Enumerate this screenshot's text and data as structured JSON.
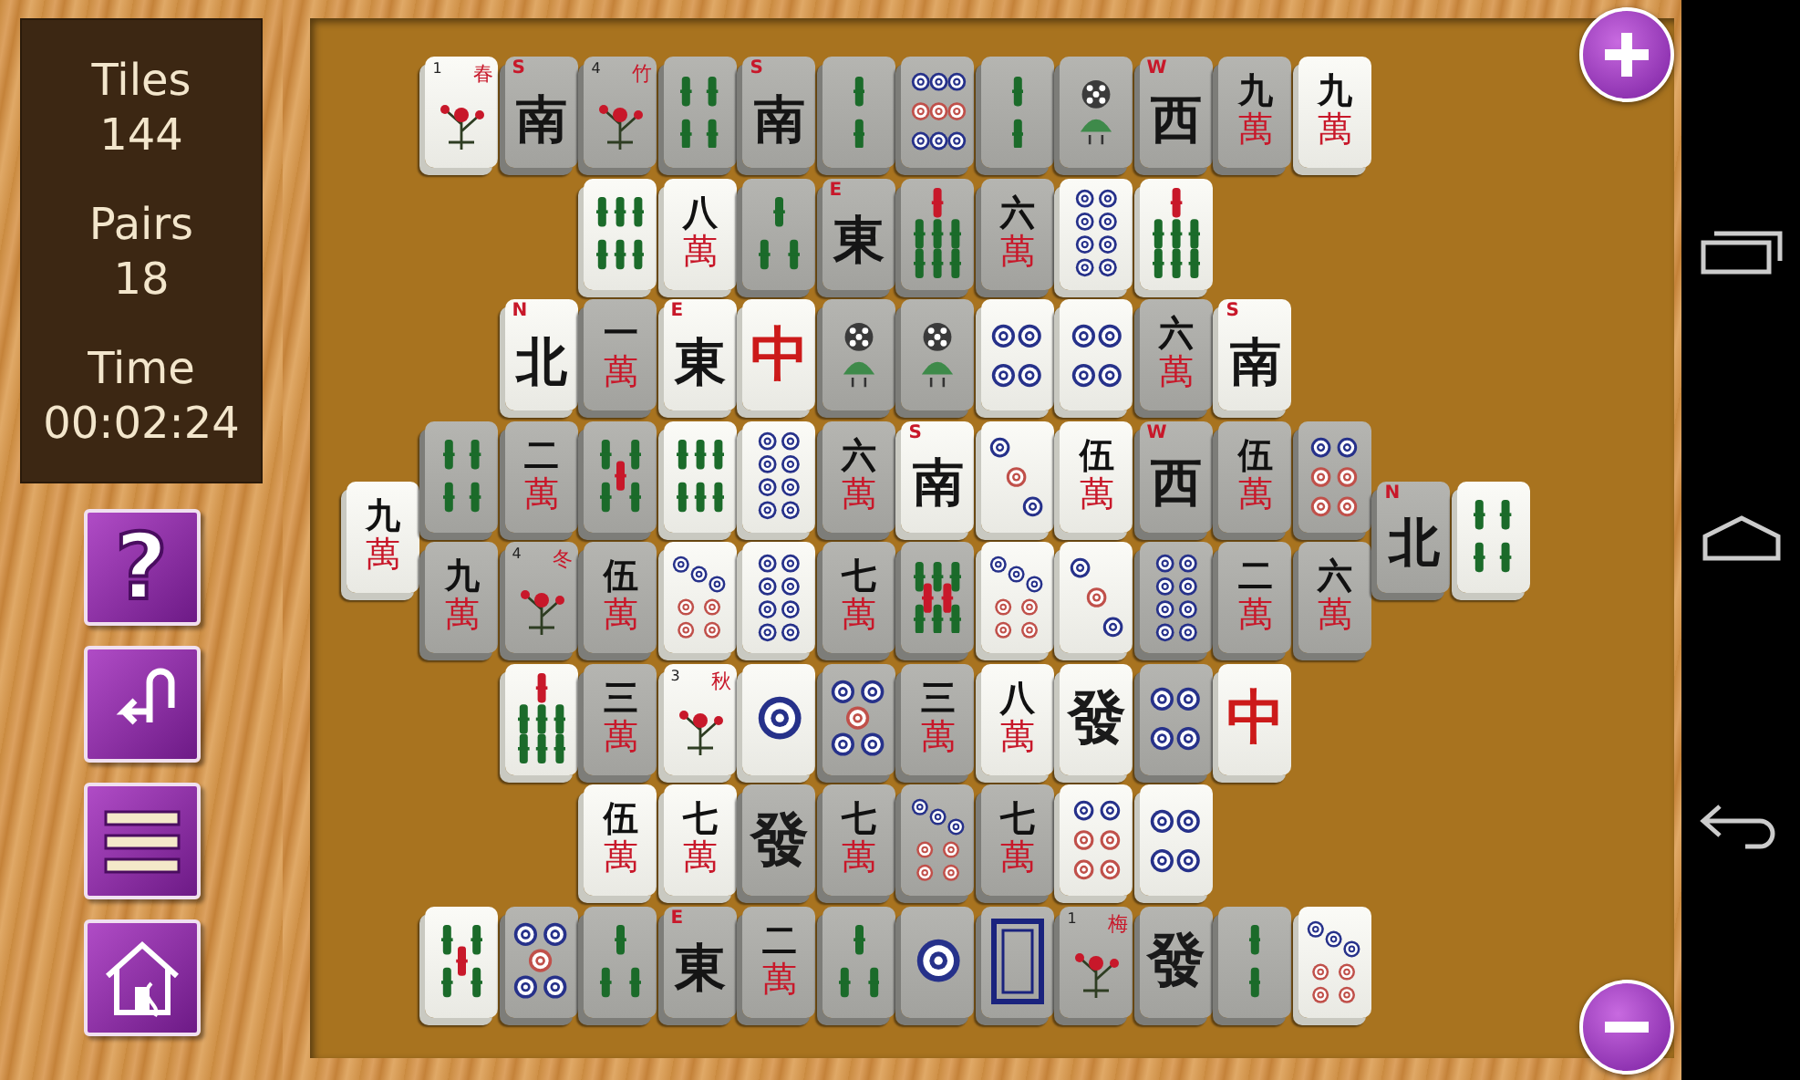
{
  "stats": [
    {
      "label": "Tiles",
      "value": "144"
    },
    {
      "label": "Pairs",
      "value": "18"
    },
    {
      "label": "Time",
      "value": "00:02:24"
    }
  ],
  "tool_buttons": [
    {
      "kind": "help",
      "text": "?"
    },
    {
      "kind": "undo"
    },
    {
      "kind": "menu"
    },
    {
      "kind": "home"
    }
  ],
  "zoom_buttons": [
    {
      "kind": "zoom-in"
    },
    {
      "kind": "zoom-out"
    }
  ],
  "board": {
    "left_tiles": [
      {
        "kind": "character",
        "rank": "九",
        "suit": "萬",
        "free": true
      }
    ],
    "rows": [
      {
        "tiles": [
          {
            "kind": "flower",
            "glyph": "春",
            "number": "1",
            "free": true
          },
          {
            "kind": "wind",
            "letter": "S",
            "glyph": "南",
            "free": false
          },
          {
            "kind": "flower",
            "glyph": "竹",
            "number": "4",
            "free": false
          },
          {
            "kind": "bamboo",
            "pips": [
              {
                "color": "#1b6b2a"
              },
              {
                "color": "#1b6b2a"
              },
              {
                "color": "#1b6b2a"
              },
              {
                "color": "#1b6b2a"
              }
            ],
            "free": false
          },
          {
            "kind": "wind",
            "letter": "S",
            "glyph": "南",
            "free": false
          },
          {
            "kind": "bamboo",
            "pips": [
              {
                "color": "#1b6b2a"
              },
              {
                "color": "#1b6b2a"
              }
            ],
            "free": false
          },
          {
            "kind": "dots",
            "pips": [
              {
                "color": "#26318a"
              },
              {
                "color": "#26318a"
              },
              {
                "color": "#26318a"
              },
              {
                "color": "#c0504a"
              },
              {
                "color": "#c0504a"
              },
              {
                "color": "#c0504a"
              },
              {
                "color": "#26318a"
              },
              {
                "color": "#26318a"
              },
              {
                "color": "#26318a"
              }
            ],
            "free": false
          },
          {
            "kind": "bamboo",
            "pips": [
              {
                "color": "#1b6b2a"
              },
              {
                "color": "#1b6b2a"
              }
            ],
            "free": false
          },
          {
            "kind": "peacock",
            "free": false
          },
          {
            "kind": "wind",
            "letter": "W",
            "glyph": "西",
            "free": false
          },
          {
            "kind": "character",
            "rank": "九",
            "suit": "萬",
            "free": false
          },
          {
            "kind": "character",
            "rank": "九",
            "suit": "萬",
            "free": true
          }
        ]
      },
      {
        "tiles": [
          {
            "kind": "bamboo",
            "pips": [
              {
                "color": "#1b6b2a"
              },
              {
                "color": "#1b6b2a"
              },
              {
                "color": "#1b6b2a"
              },
              {
                "color": "#1b6b2a"
              },
              {
                "color": "#1b6b2a"
              },
              {
                "color": "#1b6b2a"
              }
            ],
            "free": true
          },
          {
            "kind": "character",
            "rank": "八",
            "suit": "萬",
            "free": true
          },
          {
            "kind": "bamboo",
            "pips": [
              {
                "color": "#1b6b2a"
              },
              {
                "color": "#1b6b2a"
              },
              {
                "color": "#1b6b2a"
              }
            ],
            "free": false
          },
          {
            "kind": "wind",
            "letter": "E",
            "glyph": "東",
            "free": false
          },
          {
            "kind": "bamboo",
            "pips": [
              {
                "color": "#c8182a"
              },
              {
                "color": "#1b6b2a"
              },
              {
                "color": "#1b6b2a"
              },
              {
                "color": "#1b6b2a"
              },
              {
                "color": "#1b6b2a"
              },
              {
                "color": "#1b6b2a"
              },
              {
                "color": "#1b6b2a"
              }
            ],
            "free": false
          },
          {
            "kind": "character",
            "rank": "六",
            "suit": "萬",
            "free": false
          },
          {
            "kind": "dots",
            "pips": [
              {
                "color": "#26318a"
              },
              {
                "color": "#26318a"
              },
              {
                "color": "#26318a"
              },
              {
                "color": "#26318a"
              },
              {
                "color": "#26318a"
              },
              {
                "color": "#26318a"
              },
              {
                "color": "#26318a"
              },
              {
                "color": "#26318a"
              }
            ],
            "free": true
          },
          {
            "kind": "bamboo",
            "pips": [
              {
                "color": "#c8182a"
              },
              {
                "color": "#1b6b2a"
              },
              {
                "color": "#1b6b2a"
              },
              {
                "color": "#1b6b2a"
              },
              {
                "color": "#1b6b2a"
              },
              {
                "color": "#1b6b2a"
              },
              {
                "color": "#1b6b2a"
              }
            ],
            "free": true
          }
        ]
      },
      {
        "tiles": [
          {
            "kind": "wind",
            "letter": "N",
            "glyph": "北",
            "free": true
          },
          {
            "kind": "character",
            "rank": "一",
            "suit": "萬",
            "free": false
          },
          {
            "kind": "wind",
            "letter": "E",
            "glyph": "東",
            "free": true
          },
          {
            "kind": "dragon",
            "glyph": "中",
            "color": "#cc1a1a",
            "free": true
          },
          {
            "kind": "peacock",
            "free": false
          },
          {
            "kind": "peacock",
            "free": false
          },
          {
            "kind": "dots",
            "pips": [
              {
                "color": "#26318a"
              },
              {
                "color": "#26318a"
              },
              {
                "color": "#26318a"
              },
              {
                "color": "#26318a"
              }
            ],
            "free": true
          },
          {
            "kind": "dots",
            "pips": [
              {
                "color": "#26318a"
              },
              {
                "color": "#26318a"
              },
              {
                "color": "#26318a"
              },
              {
                "color": "#26318a"
              }
            ],
            "free": true
          },
          {
            "kind": "character",
            "rank": "六",
            "suit": "萬",
            "free": false
          },
          {
            "kind": "wind",
            "letter": "S",
            "glyph": "南",
            "free": true
          }
        ]
      },
      {
        "tiles": [
          {
            "kind": "bamboo",
            "pips": [
              {
                "color": "#1b6b2a"
              },
              {
                "color": "#1b6b2a"
              },
              {
                "color": "#1b6b2a"
              },
              {
                "color": "#1b6b2a"
              }
            ],
            "free": false
          },
          {
            "kind": "character",
            "rank": "二",
            "suit": "萬",
            "free": false
          },
          {
            "kind": "bamboo",
            "pips": [
              {
                "color": "#1b6b2a"
              },
              {
                "color": "#1b6b2a"
              },
              {
                "color": "#c8182a"
              },
              {
                "color": "#1b6b2a"
              },
              {
                "color": "#1b6b2a"
              }
            ],
            "free": false
          },
          {
            "kind": "bamboo",
            "pips": [
              {
                "color": "#1b6b2a"
              },
              {
                "color": "#1b6b2a"
              },
              {
                "color": "#1b6b2a"
              },
              {
                "color": "#1b6b2a"
              },
              {
                "color": "#1b6b2a"
              },
              {
                "color": "#1b6b2a"
              }
            ],
            "free": true
          },
          {
            "kind": "dots",
            "pips": [
              {
                "color": "#26318a"
              },
              {
                "color": "#26318a"
              },
              {
                "color": "#26318a"
              },
              {
                "color": "#26318a"
              },
              {
                "color": "#26318a"
              },
              {
                "color": "#26318a"
              },
              {
                "color": "#26318a"
              },
              {
                "color": "#26318a"
              }
            ],
            "free": true
          },
          {
            "kind": "character",
            "rank": "六",
            "suit": "萬",
            "free": false
          },
          {
            "kind": "wind",
            "letter": "S",
            "glyph": "南",
            "free": true
          },
          {
            "kind": "dots",
            "pips": [
              {
                "color": "#26318a"
              },
              {
                "color": "#c0504a"
              },
              {
                "color": "#26318a"
              }
            ],
            "free": true
          },
          {
            "kind": "character",
            "rank": "伍",
            "suit": "萬",
            "free": true
          },
          {
            "kind": "wind",
            "letter": "W",
            "glyph": "西",
            "free": false
          },
          {
            "kind": "character",
            "rank": "伍",
            "suit": "萬",
            "free": false
          },
          {
            "kind": "dots",
            "pips": [
              {
                "color": "#26318a"
              },
              {
                "color": "#26318a"
              },
              {
                "color": "#c0504a"
              },
              {
                "color": "#c0504a"
              },
              {
                "color": "#c0504a"
              },
              {
                "color": "#c0504a"
              }
            ],
            "free": false
          }
        ]
      },
      {
        "tiles": [
          {
            "kind": "character",
            "rank": "九",
            "suit": "萬",
            "free": false
          },
          {
            "kind": "flower",
            "glyph": "冬",
            "number": "4",
            "free": false
          },
          {
            "kind": "character",
            "rank": "伍",
            "suit": "萬",
            "free": false
          },
          {
            "kind": "dots",
            "pips": [
              {
                "color": "#26318a"
              },
              {
                "color": "#26318a"
              },
              {
                "color": "#26318a"
              },
              {
                "color": "#c0504a"
              },
              {
                "color": "#c0504a"
              },
              {
                "color": "#c0504a"
              },
              {
                "color": "#c0504a"
              }
            ],
            "free": true
          },
          {
            "kind": "dots",
            "pips": [
              {
                "color": "#26318a"
              },
              {
                "color": "#26318a"
              },
              {
                "color": "#26318a"
              },
              {
                "color": "#26318a"
              },
              {
                "color": "#26318a"
              },
              {
                "color": "#26318a"
              },
              {
                "color": "#26318a"
              },
              {
                "color": "#26318a"
              }
            ],
            "free": true
          },
          {
            "kind": "character",
            "rank": "七",
            "suit": "萬",
            "free": false
          },
          {
            "kind": "bamboo",
            "pips": [
              {
                "color": "#1b6b2a"
              },
              {
                "color": "#1b6b2a"
              },
              {
                "color": "#1b6b2a"
              },
              {
                "color": "#c8182a"
              },
              {
                "color": "#c8182a"
              },
              {
                "color": "#1b6b2a"
              },
              {
                "color": "#1b6b2a"
              },
              {
                "color": "#1b6b2a"
              }
            ],
            "free": false
          },
          {
            "kind": "dots",
            "pips": [
              {
                "color": "#26318a"
              },
              {
                "color": "#26318a"
              },
              {
                "color": "#26318a"
              },
              {
                "color": "#c0504a"
              },
              {
                "color": "#c0504a"
              },
              {
                "color": "#c0504a"
              },
              {
                "color": "#c0504a"
              }
            ],
            "free": true
          },
          {
            "kind": "dots",
            "pips": [
              {
                "color": "#26318a"
              },
              {
                "color": "#c0504a"
              },
              {
                "color": "#26318a"
              }
            ],
            "free": true
          },
          {
            "kind": "dots",
            "pips": [
              {
                "color": "#26318a"
              },
              {
                "color": "#26318a"
              },
              {
                "color": "#26318a"
              },
              {
                "color": "#26318a"
              },
              {
                "color": "#26318a"
              },
              {
                "color": "#26318a"
              },
              {
                "color": "#26318a"
              },
              {
                "color": "#26318a"
              }
            ],
            "free": false
          },
          {
            "kind": "character",
            "rank": "二",
            "suit": "萬",
            "free": false
          },
          {
            "kind": "character",
            "rank": "六",
            "suit": "萬",
            "free": false
          }
        ]
      },
      {
        "tiles": [
          {
            "kind": "bamboo",
            "pips": [
              {
                "color": "#c8182a"
              },
              {
                "color": "#1b6b2a"
              },
              {
                "color": "#1b6b2a"
              },
              {
                "color": "#1b6b2a"
              },
              {
                "color": "#1b6b2a"
              },
              {
                "color": "#1b6b2a"
              },
              {
                "color": "#1b6b2a"
              }
            ],
            "free": true
          },
          {
            "kind": "character",
            "rank": "三",
            "suit": "萬",
            "free": false
          },
          {
            "kind": "flower",
            "glyph": "秋",
            "number": "3",
            "free": true
          },
          {
            "kind": "dots",
            "pips": [
              {
                "color": "#26318a"
              }
            ],
            "free": true
          },
          {
            "kind": "dots",
            "pips": [
              {
                "color": "#26318a"
              },
              {
                "color": "#26318a"
              },
              {
                "color": "#c0504a"
              },
              {
                "color": "#26318a"
              },
              {
                "color": "#26318a"
              }
            ],
            "free": false
          },
          {
            "kind": "character",
            "rank": "三",
            "suit": "萬",
            "free": false
          },
          {
            "kind": "character",
            "rank": "八",
            "suit": "萬",
            "free": true
          },
          {
            "kind": "dragon",
            "glyph": "發",
            "color": "#1a1a1a",
            "free": true
          },
          {
            "kind": "dots",
            "pips": [
              {
                "color": "#26318a"
              },
              {
                "color": "#26318a"
              },
              {
                "color": "#26318a"
              },
              {
                "color": "#26318a"
              }
            ],
            "free": false
          },
          {
            "kind": "dragon",
            "glyph": "中",
            "color": "#cc1a1a",
            "free": true
          }
        ]
      },
      {
        "tiles": [
          {
            "kind": "character",
            "rank": "伍",
            "suit": "萬",
            "free": true
          },
          {
            "kind": "character",
            "rank": "七",
            "suit": "萬",
            "free": true
          },
          {
            "kind": "dragon",
            "glyph": "發",
            "color": "#1a1a1a",
            "free": false
          },
          {
            "kind": "character",
            "rank": "七",
            "suit": "萬",
            "free": false
          },
          {
            "kind": "dots",
            "pips": [
              {
                "color": "#26318a"
              },
              {
                "color": "#26318a"
              },
              {
                "color": "#26318a"
              },
              {
                "color": "#c0504a"
              },
              {
                "color": "#c0504a"
              },
              {
                "color": "#c0504a"
              },
              {
                "color": "#c0504a"
              }
            ],
            "free": false
          },
          {
            "kind": "character",
            "rank": "七",
            "suit": "萬",
            "free": false
          },
          {
            "kind": "dots",
            "pips": [
              {
                "color": "#26318a"
              },
              {
                "color": "#26318a"
              },
              {
                "color": "#c0504a"
              },
              {
                "color": "#c0504a"
              },
              {
                "color": "#c0504a"
              },
              {
                "color": "#c0504a"
              }
            ],
            "free": true
          },
          {
            "kind": "dots",
            "pips": [
              {
                "color": "#26318a"
              },
              {
                "color": "#26318a"
              },
              {
                "color": "#26318a"
              },
              {
                "color": "#26318a"
              }
            ],
            "free": true
          }
        ]
      },
      {
        "tiles": [
          {
            "kind": "bamboo",
            "pips": [
              {
                "color": "#1b6b2a"
              },
              {
                "color": "#1b6b2a"
              },
              {
                "color": "#c8182a"
              },
              {
                "color": "#1b6b2a"
              },
              {
                "color": "#1b6b2a"
              }
            ],
            "free": true
          },
          {
            "kind": "dots",
            "pips": [
              {
                "color": "#26318a"
              },
              {
                "color": "#26318a"
              },
              {
                "color": "#c0504a"
              },
              {
                "color": "#26318a"
              },
              {
                "color": "#26318a"
              }
            ],
            "free": false
          },
          {
            "kind": "bamboo",
            "pips": [
              {
                "color": "#1b6b2a"
              },
              {
                "color": "#1b6b2a"
              },
              {
                "color": "#1b6b2a"
              }
            ],
            "free": false
          },
          {
            "kind": "wind",
            "letter": "E",
            "glyph": "東",
            "free": false
          },
          {
            "kind": "character",
            "rank": "二",
            "suit": "萬",
            "free": false
          },
          {
            "kind": "bamboo",
            "pips": [
              {
                "color": "#1b6b2a"
              },
              {
                "color": "#1b6b2a"
              },
              {
                "color": "#1b6b2a"
              }
            ],
            "free": false
          },
          {
            "kind": "dots",
            "pips": [
              {
                "color": "#26318a"
              }
            ],
            "free": false
          },
          {
            "kind": "white",
            "free": false
          },
          {
            "kind": "flower",
            "glyph": "梅",
            "number": "1",
            "free": false
          },
          {
            "kind": "dragon",
            "glyph": "發",
            "color": "#1a1a1a",
            "free": false
          },
          {
            "kind": "bamboo",
            "pips": [
              {
                "color": "#1b6b2a"
              },
              {
                "color": "#1b6b2a"
              }
            ],
            "free": false
          },
          {
            "kind": "dots",
            "pips": [
              {
                "color": "#26318a"
              },
              {
                "color": "#26318a"
              },
              {
                "color": "#26318a"
              },
              {
                "color": "#c0504a"
              },
              {
                "color": "#c0504a"
              },
              {
                "color": "#c0504a"
              },
              {
                "color": "#c0504a"
              }
            ],
            "free": true
          }
        ]
      }
    ],
    "right_tiles": [
      {
        "kind": "wind",
        "letter": "N",
        "glyph": "北",
        "free": false
      },
      {
        "kind": "bamboo",
        "pips": [
          {
            "color": "#1b6b2a"
          },
          {
            "color": "#1b6b2a"
          },
          {
            "color": "#1b6b2a"
          },
          {
            "color": "#1b6b2a"
          }
        ],
        "free": true
      }
    ]
  }
}
